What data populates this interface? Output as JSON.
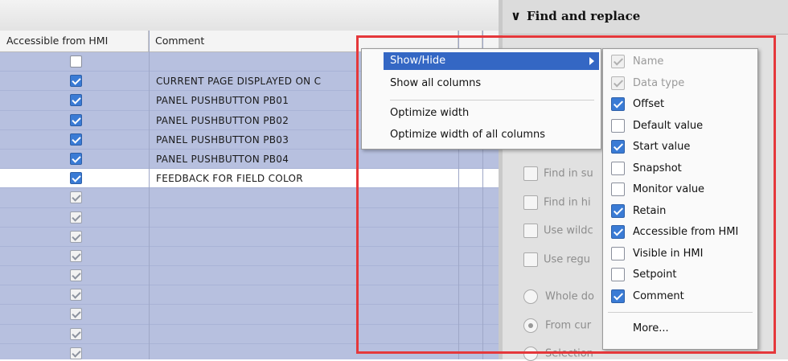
{
  "table": {
    "headers": [
      "Accessible from HMI",
      "Comment"
    ],
    "rows": [
      {
        "checked": "off",
        "comment": ""
      },
      {
        "checked": "on",
        "comment": "CURRENT PAGE DISPLAYED ON C"
      },
      {
        "checked": "on",
        "comment": "PANEL PUSHBUTTON PB01"
      },
      {
        "checked": "on",
        "comment": "PANEL PUSHBUTTON PB02"
      },
      {
        "checked": "on",
        "comment": "PANEL PUSHBUTTON PB03"
      },
      {
        "checked": "on",
        "comment": "PANEL PUSHBUTTON PB04"
      },
      {
        "checked": "on",
        "comment": "FEEDBACK FOR FIELD COLOR",
        "selected": true
      },
      {
        "checked": "dim",
        "comment": ""
      },
      {
        "checked": "dim",
        "comment": ""
      },
      {
        "checked": "dim",
        "comment": ""
      },
      {
        "checked": "dim",
        "comment": ""
      },
      {
        "checked": "dim",
        "comment": ""
      },
      {
        "checked": "dim",
        "comment": ""
      },
      {
        "checked": "dim",
        "comment": ""
      },
      {
        "checked": "dim",
        "comment": ""
      },
      {
        "checked": "dim",
        "comment": ""
      }
    ]
  },
  "panel": {
    "title": "Find and replace",
    "options": [
      "Find in su",
      "Find in hi",
      "Use wildc",
      "Use regu"
    ],
    "radios": [
      "Whole do",
      "From cur",
      "Selection"
    ]
  },
  "context_menu": {
    "items": [
      "Show/Hide",
      "Show all columns",
      "Optimize width",
      "Optimize width of all columns"
    ]
  },
  "submenu": {
    "items": [
      {
        "label": "Name",
        "state": "disabled"
      },
      {
        "label": "Data type",
        "state": "disabled"
      },
      {
        "label": "Offset",
        "state": "on"
      },
      {
        "label": "Default value",
        "state": "off"
      },
      {
        "label": "Start value",
        "state": "on"
      },
      {
        "label": "Snapshot",
        "state": "off"
      },
      {
        "label": "Monitor value",
        "state": "off"
      },
      {
        "label": "Retain",
        "state": "on"
      },
      {
        "label": "Accessible from HMI",
        "state": "on"
      },
      {
        "label": "Visible in HMI",
        "state": "off"
      },
      {
        "label": "Setpoint",
        "state": "off"
      },
      {
        "label": "Comment",
        "state": "on"
      }
    ],
    "more": "More..."
  },
  "colors": {
    "highlight": "#e5383b",
    "menu_selected": "#3467c4",
    "checkbox_on": "#3a7bd5",
    "row_bg": "#b7c0df"
  }
}
